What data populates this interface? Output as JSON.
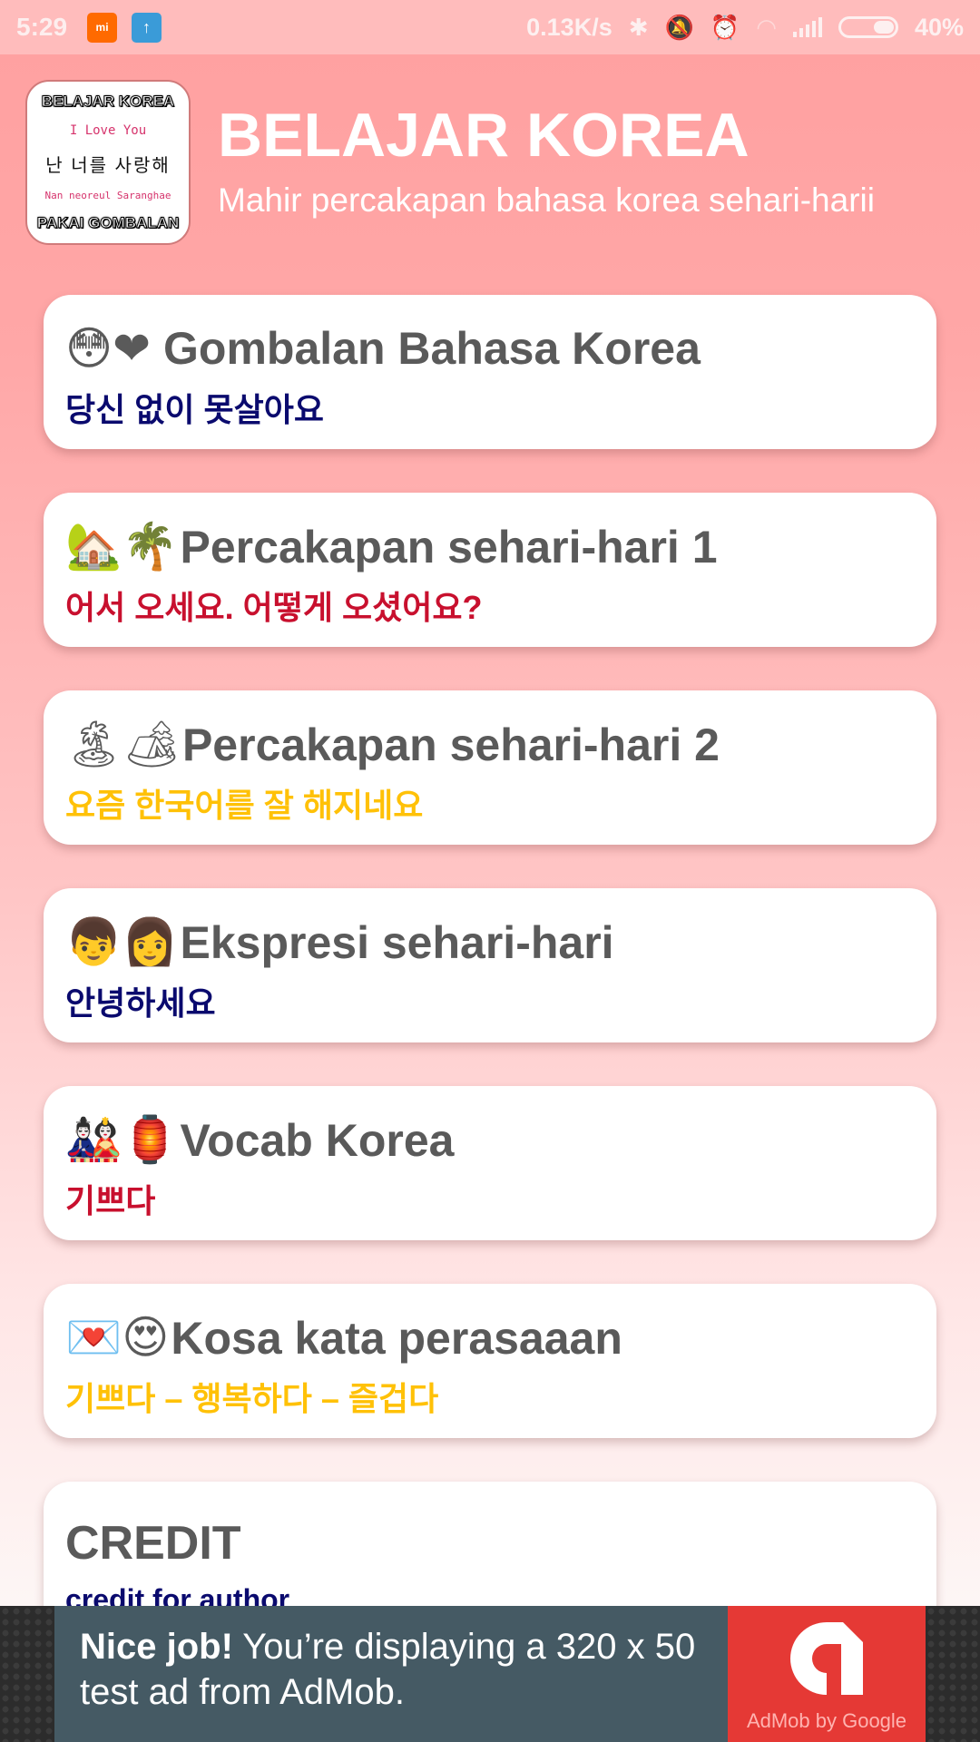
{
  "status_bar": {
    "time": "5:29",
    "notification_icons": [
      "mi-app-icon",
      "upload-arrow-icon"
    ],
    "network_speed": "0.13K/s",
    "icons": [
      "bluetooth-icon",
      "silent-bell-icon",
      "alarm-clock-icon",
      "wifi-icon",
      "cell-signal-icon",
      "battery-icon"
    ],
    "battery_percent": "40%",
    "battery_level": 0.4
  },
  "header": {
    "logo": {
      "top_text": "BELAJAR KOREA",
      "love_text": "I Love You",
      "korean_text": "난 너를 사랑해",
      "romanized_text": "Nan neoreul Saranghae",
      "bottom_text": "PAKAI GOMBALAN"
    },
    "title": "BELAJAR KOREA",
    "subtitle": "Mahir percakapan bahasa korea sehari-harii"
  },
  "menu": [
    {
      "emoji": "😳❤",
      "emoji_names": [
        "blushing-face-icon",
        "heart-icon"
      ],
      "title": "Gombalan Bahasa Korea",
      "subtitle": "당신 없이 못살아요",
      "subtitle_color": "#0a0a6e"
    },
    {
      "emoji": "🏡🌴",
      "emoji_names": [
        "house-garden-icon",
        "palm-tree-icon"
      ],
      "title": "Percakapan sehari-hari 1",
      "subtitle": "어서 오세요. 어떻게 오셨어요?",
      "subtitle_color": "#c8102e"
    },
    {
      "emoji": "🏝🏕",
      "emoji_names": [
        "island-icon",
        "camping-icon"
      ],
      "title": "Percakapan sehari-hari 2",
      "subtitle": "요즘 한국어를 잘 해지네요",
      "subtitle_color": "#ffc107"
    },
    {
      "emoji": "👦👩",
      "emoji_names": [
        "boy-icon",
        "woman-icon"
      ],
      "title": "Ekspresi sehari-hari",
      "subtitle": "안녕하세요",
      "subtitle_color": "#0a0a6e"
    },
    {
      "emoji": "🎎🏮",
      "emoji_names": [
        "dolls-icon",
        "lantern-icon"
      ],
      "title": "Vocab Korea",
      "subtitle": "기쁘다",
      "subtitle_color": "#c8102e"
    },
    {
      "emoji": "💌😍",
      "emoji_names": [
        "love-letter-icon",
        "heart-eyes-icon"
      ],
      "title": "Kosa kata perasaaan",
      "subtitle": "기쁘다 – 행복하다 – 즐겁다",
      "subtitle_color": "#ffc107"
    }
  ],
  "credit": {
    "title": "CREDIT",
    "subtitle": "credit for author"
  },
  "ad": {
    "bold_text": "Nice job!",
    "text": " You’re displaying a 320 x 50 test ad from AdMob.",
    "brand_caption": "AdMob by Google",
    "colors": {
      "text_bg": "#455a64",
      "brand_bg": "#e53935"
    }
  },
  "colors": {
    "header_pink": "#ffa0a0",
    "card_title": "#5a5a5a",
    "navy": "#0a0a6e",
    "red": "#c8102e",
    "yellow": "#ffc107"
  }
}
